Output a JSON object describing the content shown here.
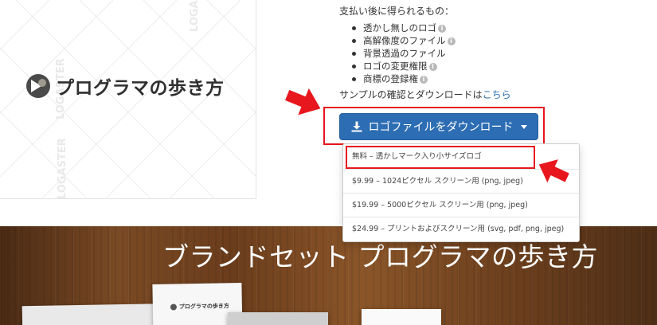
{
  "preview": {
    "logo_text": "プログラマの歩き方",
    "watermark": "LOGASTER"
  },
  "info": {
    "heading": "支払い後に得られるもの：",
    "benefits": [
      {
        "label": "透かし無しのロゴ"
      },
      {
        "label": "高解像度のファイル"
      },
      {
        "label": "背景透過のファイル"
      },
      {
        "label": "ロゴの変更権限"
      },
      {
        "label": "商標の登録権"
      }
    ],
    "info_glyph": "i",
    "sample_text": "サンプルの確認とダウンロードは",
    "sample_link": "こちら"
  },
  "download": {
    "label": "ロゴファイルをダウンロード",
    "menu": [
      {
        "label": "無料 – 透かしマーク入り小サイズロゴ"
      },
      {
        "label": "$9.99 – 1024ピクセル スクリーン用 (png, jpeg)"
      },
      {
        "label": "$19.99 – 5000ピクセル スクリーン用 (png, jpeg)"
      },
      {
        "label": "$24.99 – プリントおよびスクリーン用 (svg, pdf, png, jpeg)"
      }
    ]
  },
  "banner": {
    "title": "ブランドセット プログラマの歩き方",
    "paper_logo": "プログラマの歩き方"
  },
  "colors": {
    "accent_blue": "#2c6db3",
    "highlight_red": "#e8161d",
    "link": "#2a6fb0"
  }
}
